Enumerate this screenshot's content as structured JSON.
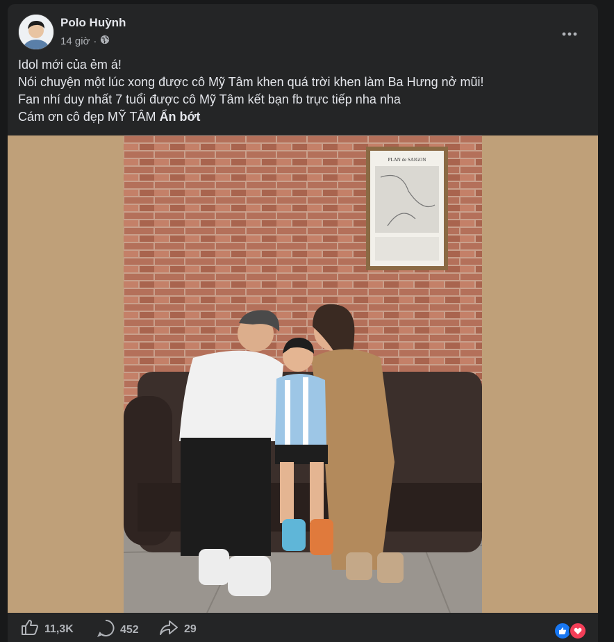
{
  "post": {
    "author": "Polo Huỳnh",
    "time": "14 giờ",
    "separator": "·",
    "caption_lines": [
      "Idol mới của ẻm á!",
      "Nói chuyện một lúc xong được cô Mỹ Tâm khen quá trời khen làm Ba Hưng nở mũi!",
      "Fan nhí duy nhất 7 tuổi được cô Mỹ Tâm kết bạn fb trực tiếp nha nha",
      "Cám ơn cô đẹp MỸ TÂM"
    ],
    "see_less": "Ẩn bớt",
    "plaque_text": "PLAN de SAIGON"
  },
  "footer": {
    "likes": "11,3K",
    "comments": "452",
    "shares": "29"
  },
  "colors": {
    "background": "#18191a",
    "card": "#242526",
    "text_primary": "#e4e6eb",
    "text_secondary": "#b0b3b8",
    "like_blue": "#1877f2",
    "love_red": "#f33e58",
    "media_backdrop": "#bfa079"
  },
  "icons": [
    "globe-icon",
    "more-icon",
    "like-icon",
    "comment-icon",
    "share-icon",
    "like-reaction-icon",
    "love-reaction-icon"
  ]
}
